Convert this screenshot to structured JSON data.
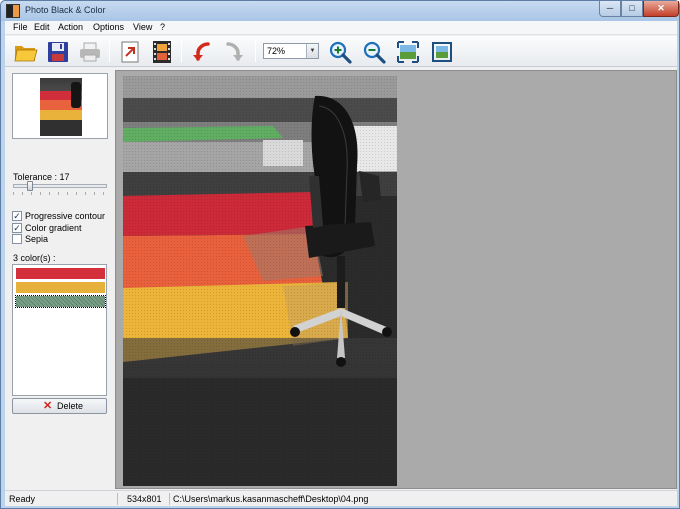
{
  "window": {
    "title": "Photo Black & Color",
    "buttons": {
      "minimize": "─",
      "maximize": "□",
      "close": "✕"
    }
  },
  "menu": [
    "File",
    "Edit",
    "Action",
    "Options",
    "View",
    "?"
  ],
  "toolbar": {
    "icons": [
      "open-folder-icon",
      "save-icon",
      "print-icon",
      "export-icon",
      "film-strip-icon",
      "undo-icon",
      "redo-icon",
      "zoom-in-icon",
      "zoom-out-icon",
      "fit-to-window-icon",
      "actual-size-icon"
    ],
    "zoom_value": "72%"
  },
  "panel": {
    "tolerance_label": "Tolerance : 17",
    "tolerance_value": 17,
    "checkboxes": [
      {
        "label": "Progressive contour",
        "checked": true
      },
      {
        "label": "Color gradient",
        "checked": true
      },
      {
        "label": "Sepia",
        "checked": false
      }
    ],
    "colors_label": "3 color(s) :",
    "colors": [
      "#d4303b",
      "#e6b13b",
      "#7b9e86"
    ],
    "delete_label": "Delete"
  },
  "status": {
    "state": "Ready",
    "dimensions": "534x801",
    "path": "C:\\Users\\markus.kasanmascheff\\Desktop\\04.png"
  }
}
